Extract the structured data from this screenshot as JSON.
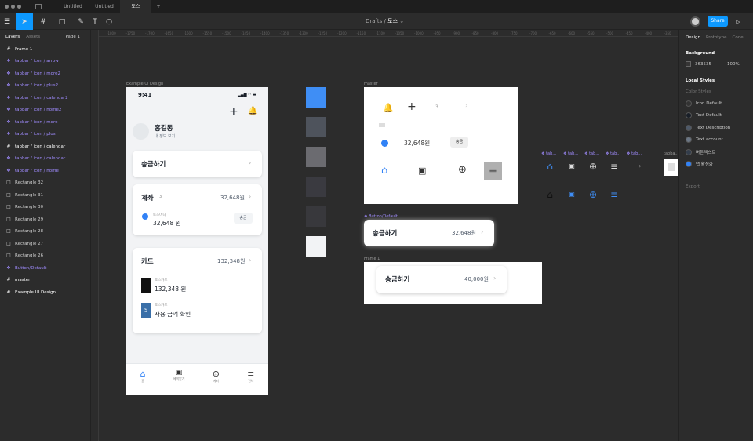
{
  "tabs": [
    "Untitled",
    "Untitled",
    "토스"
  ],
  "toolbar": {
    "crumb_parent": "Drafts",
    "crumb_sep": "/",
    "crumb_current": "토스",
    "share": "Share",
    "play": "▷"
  },
  "left_panel": {
    "tab_layers": "Layers",
    "tab_assets": "Assets",
    "page": "Page 1",
    "layers": [
      {
        "label": "Frame 1",
        "kind": "frame"
      },
      {
        "label": "tabbar / icon / arrow",
        "kind": "comp"
      },
      {
        "label": "tabbar / icon / more2",
        "kind": "comp"
      },
      {
        "label": "tabbar / icon / plus2",
        "kind": "comp"
      },
      {
        "label": "tabbar / icon / calendar2",
        "kind": "comp"
      },
      {
        "label": "tabbar / icon / home2",
        "kind": "comp"
      },
      {
        "label": "tabbar / icon / more",
        "kind": "comp"
      },
      {
        "label": "tabbar / icon / plus",
        "kind": "comp"
      },
      {
        "label": "tabbar / icon / calendar",
        "kind": "frame"
      },
      {
        "label": "tabbar / icon / calendar",
        "kind": "comp"
      },
      {
        "label": "tabbar / icon / home",
        "kind": "comp"
      },
      {
        "label": "Rectangle 32",
        "kind": "rect"
      },
      {
        "label": "Rectangle 31",
        "kind": "rect"
      },
      {
        "label": "Rectangle 30",
        "kind": "rect"
      },
      {
        "label": "Rectangle 29",
        "kind": "rect"
      },
      {
        "label": "Rectangle 28",
        "kind": "rect"
      },
      {
        "label": "Rectangle 27",
        "kind": "rect"
      },
      {
        "label": "Rectangle 26",
        "kind": "rect"
      },
      {
        "label": "Button/Default",
        "kind": "comp"
      },
      {
        "label": "master",
        "kind": "frame"
      },
      {
        "label": "Example UI Design",
        "kind": "frame"
      }
    ]
  },
  "right_panel": {
    "tabs": [
      "Design",
      "Prototype",
      "Code"
    ],
    "background_title": "Background",
    "bg_hex": "363535",
    "bg_opacity": "100%",
    "local_styles": "Local Styles",
    "color_styles": "Color Styles",
    "styles": [
      {
        "name": "Icon Default",
        "color": "#333333"
      },
      {
        "name": "Text Default",
        "color": "#191f28"
      },
      {
        "name": "Text Description",
        "color": "#4e5968"
      },
      {
        "name": "Text account",
        "color": "#6b7684"
      },
      {
        "name": "버튼텍스트",
        "color": "#333d4b"
      },
      {
        "name": "탭 활성화",
        "color": "#3182f6"
      }
    ],
    "export": "Export"
  },
  "canvas": {
    "ruler_ticks": [
      "-1800",
      "-1750",
      "-1700",
      "-1650",
      "-1600",
      "-1550",
      "-1500",
      "-1450",
      "-1400",
      "-1350",
      "-1300",
      "-1250",
      "-1200",
      "-1150",
      "-1100",
      "-1050",
      "-1000",
      "-950",
      "-900",
      "-850",
      "-800",
      "-750",
      "-700",
      "-650",
      "-600",
      "-550",
      "-500",
      "-450",
      "-400",
      "-350",
      "-300"
    ],
    "frame_label_example": "Example UI Design",
    "frame_label_master": "master",
    "frame_label_button": "❖ Button/Default",
    "frame_label_frame1": "Frame 1",
    "comp_labels": [
      "❖ tab...",
      "❖ tab...",
      "❖ tab...",
      "❖ tab...",
      "❖ tab...",
      "tabba..."
    ]
  },
  "phone": {
    "time": "9:41",
    "name": "홍길동",
    "profile_sub": "내 정보 보기",
    "transfer": "송금하기",
    "account_title": "계좌",
    "account_count": "3",
    "account_total": "32,648원",
    "toss_money": "토스머니",
    "toss_money_amount": "32,648 원",
    "send": "송금",
    "card_title": "카드",
    "card_total": "132,348원",
    "card1_label": "토스카드",
    "card1_amount": "132,348 원",
    "card2_label": "토스카드",
    "card2_text": "사용 금액 확인",
    "nav": [
      "홈",
      "혜택받기",
      "계좌",
      "전체"
    ]
  },
  "master": {
    "badge": "3",
    "amount": "32,648원",
    "send": "송금",
    "small": "..."
  },
  "button_default": {
    "label": "송금하기",
    "amount": "32,648원"
  },
  "frame1": {
    "label": "송금하기",
    "amount": "40,000원"
  },
  "colors": {
    "accent": "#0d99ff",
    "tab_active": "#3182f6"
  }
}
